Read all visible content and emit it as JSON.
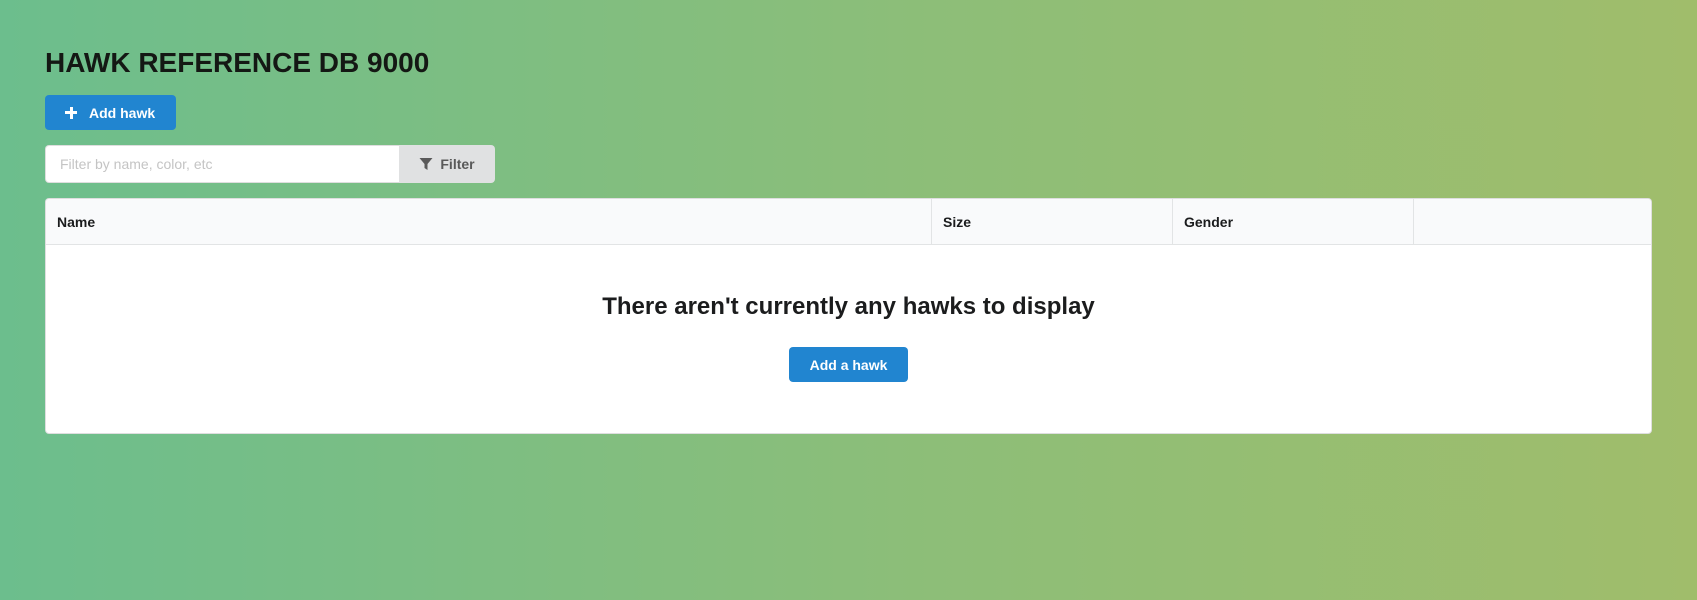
{
  "header": {
    "title": "HAWK REFERENCE DB 9000",
    "add_button_label": "Add hawk",
    "add_button_icon": "plus-icon"
  },
  "filter": {
    "placeholder": "Filter by name, color, etc",
    "value": "",
    "button_label": "Filter",
    "button_icon": "filter-icon"
  },
  "table": {
    "columns": [
      "Name",
      "Size",
      "Gender",
      ""
    ],
    "rows": []
  },
  "empty_state": {
    "message": "There aren't currently any hawks to display",
    "button_label": "Add a hawk"
  },
  "colors": {
    "primary": "#2185d0",
    "background_gradient": [
      "#6cbe8d",
      "#a0bd6b"
    ]
  }
}
